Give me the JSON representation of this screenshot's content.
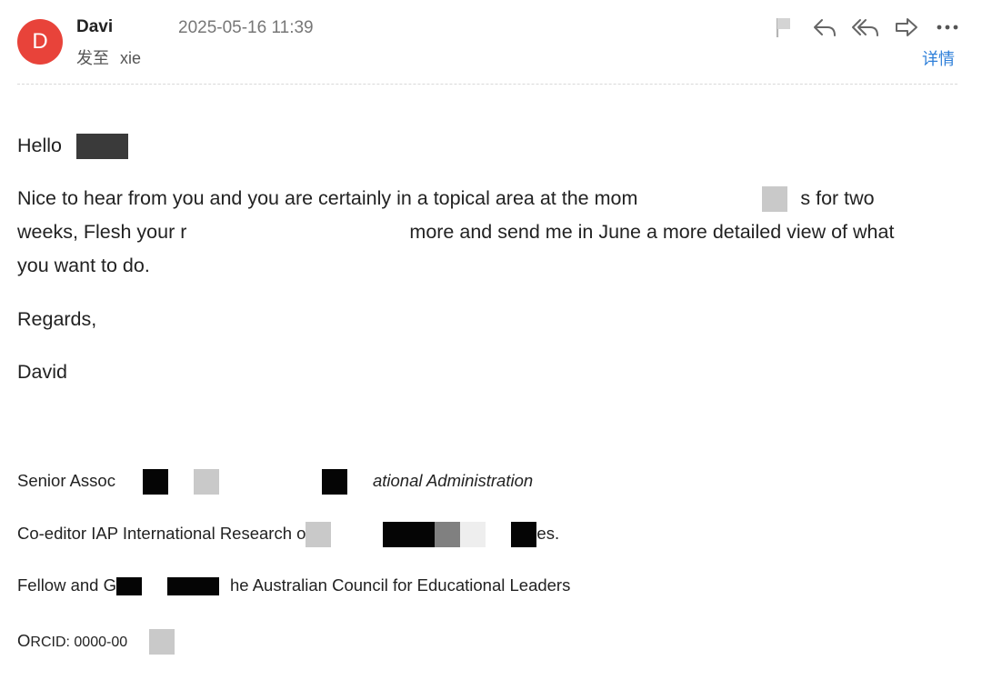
{
  "header": {
    "avatar_letter": "D",
    "sender_name": "Davi",
    "datetime": "2025-05-16 11:39",
    "to_label": "发至",
    "to_value": "xie",
    "details_label": "详情",
    "icons": [
      "flag-icon",
      "reply-icon",
      "reply-all-icon",
      "forward-icon",
      "more-icon"
    ]
  },
  "body": {
    "greeting": "Hello",
    "para_line1_a": "Nice to hear from you and you are certainly in a topical area at the mom",
    "para_line1_b": "s for two",
    "para_line2_a": "weeks, Flesh your r",
    "para_line2_b": "more and send me in June a more detailed view of what",
    "para_line3": "you want to do.",
    "regards": "Regards,",
    "name": "David"
  },
  "signature": {
    "line1_a": "Senior Assoc",
    "line1_b": "ational Administration",
    "line2_a": "Co-editor IAP International Research o",
    "line2_b": "es.",
    "line3_a": "Fellow and G",
    "line3_b": "he Australian Council for Educational Leaders",
    "orcid_label_a": "O",
    "orcid_label_b": "RCID",
    "orcid_value": ": 0000-00"
  },
  "colors": {
    "avatar": "#e8433a",
    "link": "#2e7fd9",
    "text": "#222222",
    "muted": "#777777"
  }
}
